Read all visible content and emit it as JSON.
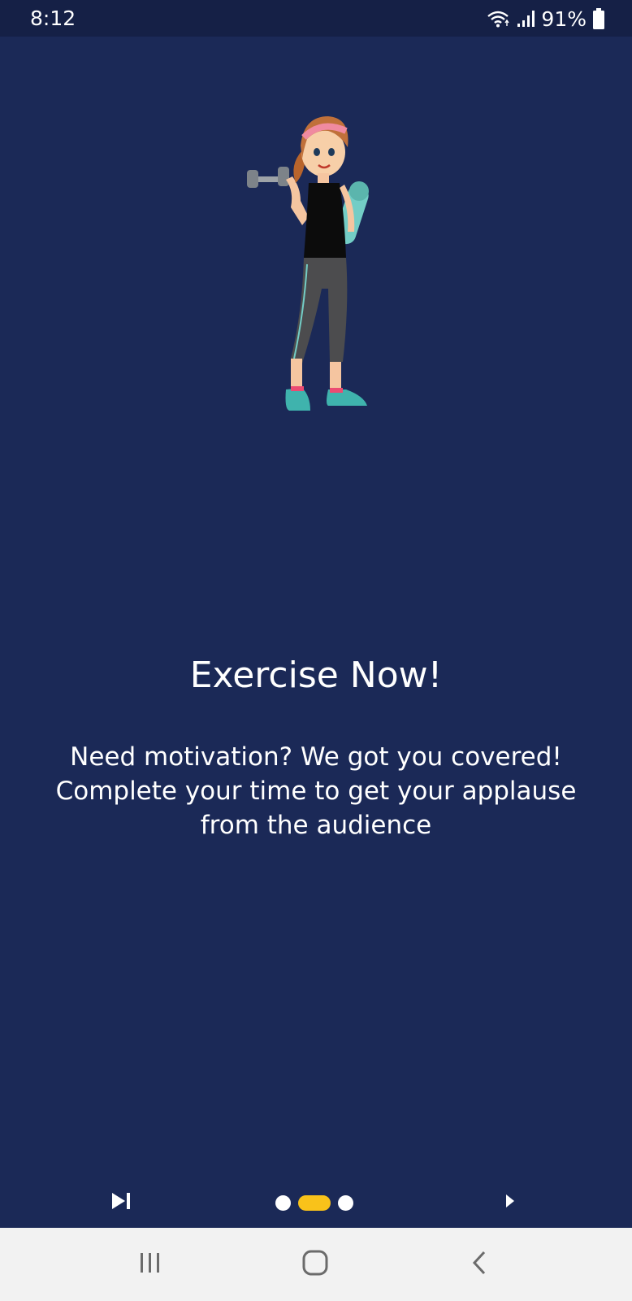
{
  "status_bar": {
    "time": "8:12",
    "battery_percent": "91%",
    "icons": [
      "wifi-icon",
      "signal-icon",
      "battery-icon"
    ]
  },
  "onboarding": {
    "illustration": "woman-with-dumbbell-and-yoga-mat",
    "title": "Exercise Now!",
    "description": "Need motivation? We got you covered! Complete your time to get your applause from the audience",
    "page_indicator": {
      "total": 3,
      "current": 2
    },
    "skip_icon": "skip-next-icon",
    "next_icon": "arrow-right-icon",
    "accent_color": "#f9c21a",
    "background_color": "#1b2957"
  },
  "nav_bar": {
    "icons": [
      "recent-apps-icon",
      "home-icon",
      "back-icon"
    ]
  }
}
